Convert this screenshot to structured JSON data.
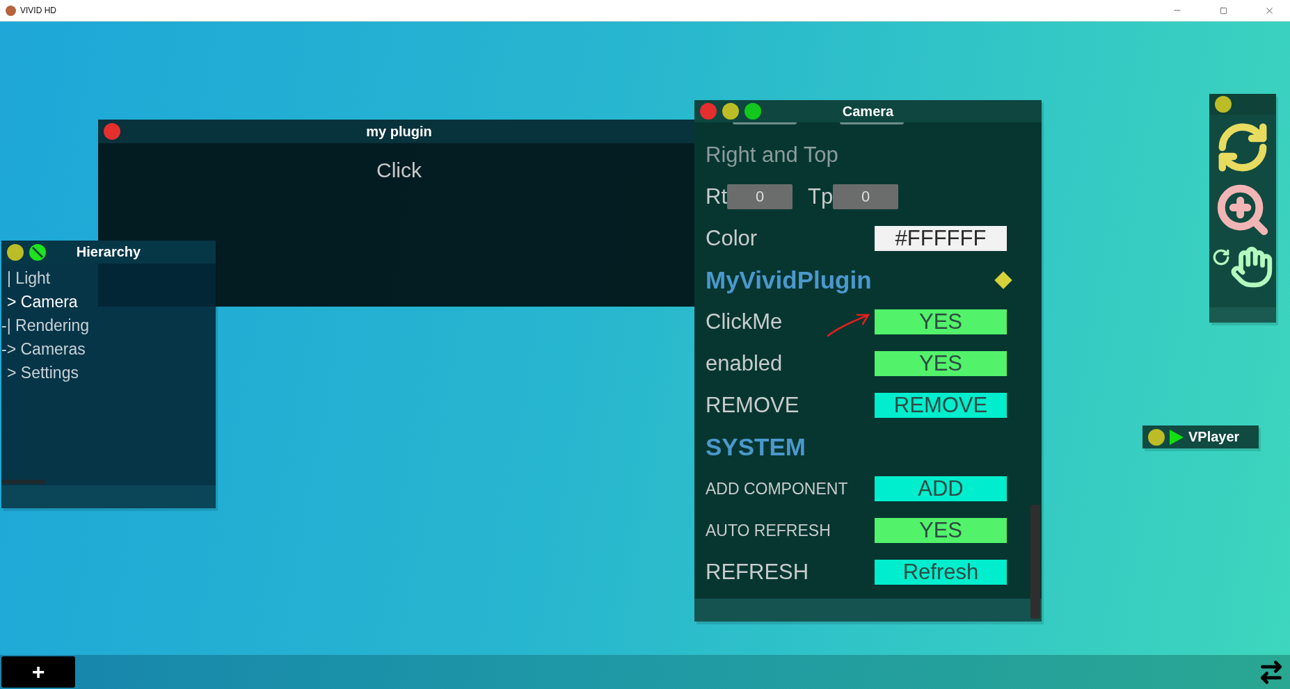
{
  "app_title": "VIVID HD",
  "hierarchy": {
    "title": "Hierarchy",
    "items": [
      {
        "label": "| Light",
        "selected": false
      },
      {
        "label": "> Camera",
        "selected": true
      },
      {
        "label": "-| Rendering",
        "selected": false
      },
      {
        "label": "-> Cameras",
        "selected": false
      },
      {
        "label": "> Settings",
        "selected": false
      }
    ]
  },
  "plugin": {
    "title": "my plugin",
    "button": "Click"
  },
  "camera": {
    "title": "Camera",
    "rows": [
      {
        "kind": "heading",
        "label": "Right and Top"
      },
      {
        "kind": "pair",
        "fields": [
          {
            "label": "Rt",
            "value": "0"
          },
          {
            "label": "Tp",
            "value": "0"
          }
        ]
      },
      {
        "kind": "color",
        "label": "Color",
        "value": "#FFFFFF"
      },
      {
        "kind": "section",
        "label": "MyVividPlugin",
        "marker": true
      },
      {
        "kind": "toggle",
        "label": "ClickMe",
        "value": "YES",
        "on": true,
        "compact": false
      },
      {
        "kind": "toggle",
        "label": "enabled",
        "value": "YES",
        "on": true,
        "compact": false
      },
      {
        "kind": "action",
        "label": "REMOVE",
        "value": "REMOVE",
        "compact": false
      },
      {
        "kind": "section",
        "label": "SYSTEM"
      },
      {
        "kind": "action",
        "label": "ADD COMPONENT",
        "value": "ADD",
        "compact": true
      },
      {
        "kind": "toggle",
        "label": "AUTO REFRESH",
        "value": "YES",
        "on": true,
        "compact": true
      },
      {
        "kind": "action",
        "label": "REFRESH",
        "value": "Refresh",
        "compact": false
      }
    ]
  },
  "vplayer": {
    "title": "VPlayer"
  },
  "bottom_bar": {
    "add_button": "+"
  }
}
